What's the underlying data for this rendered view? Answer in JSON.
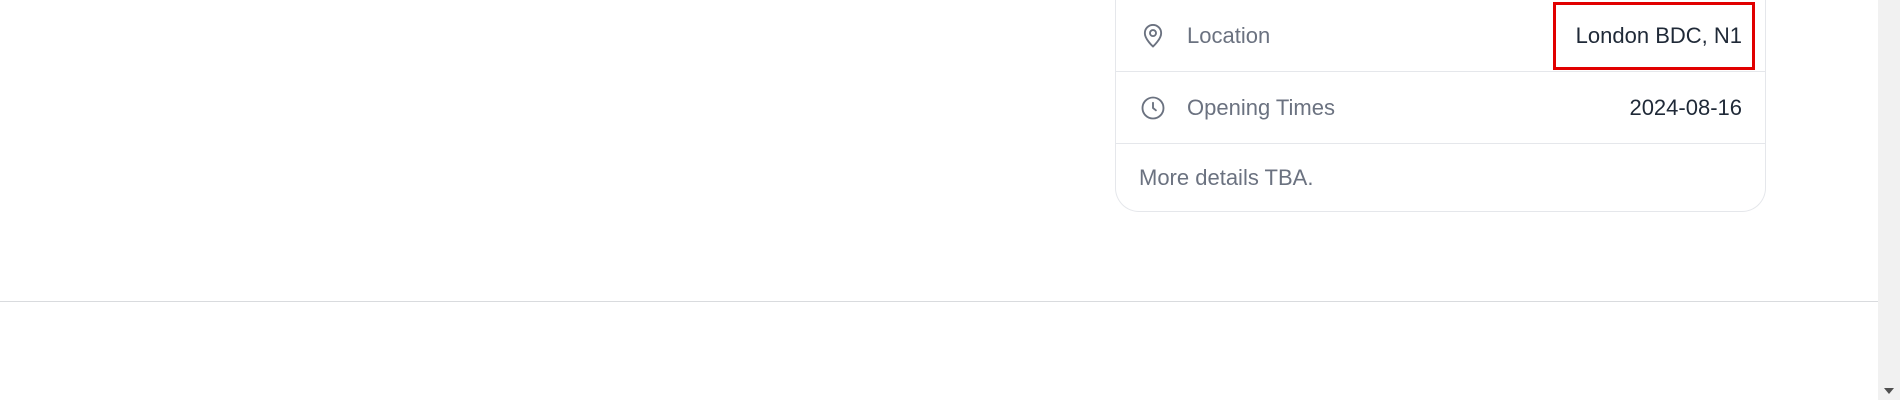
{
  "details": {
    "location": {
      "icon": "map-pin-icon",
      "label": "Location",
      "value": "London BDC, N1"
    },
    "opening_times": {
      "icon": "clock-icon",
      "label": "Opening Times",
      "value": "2024-08-16"
    },
    "note": "More details TBA."
  },
  "colors": {
    "label_text": "#6b7280",
    "value_text": "#1f2937",
    "highlight": "#e10000",
    "border": "#e5e7eb"
  }
}
